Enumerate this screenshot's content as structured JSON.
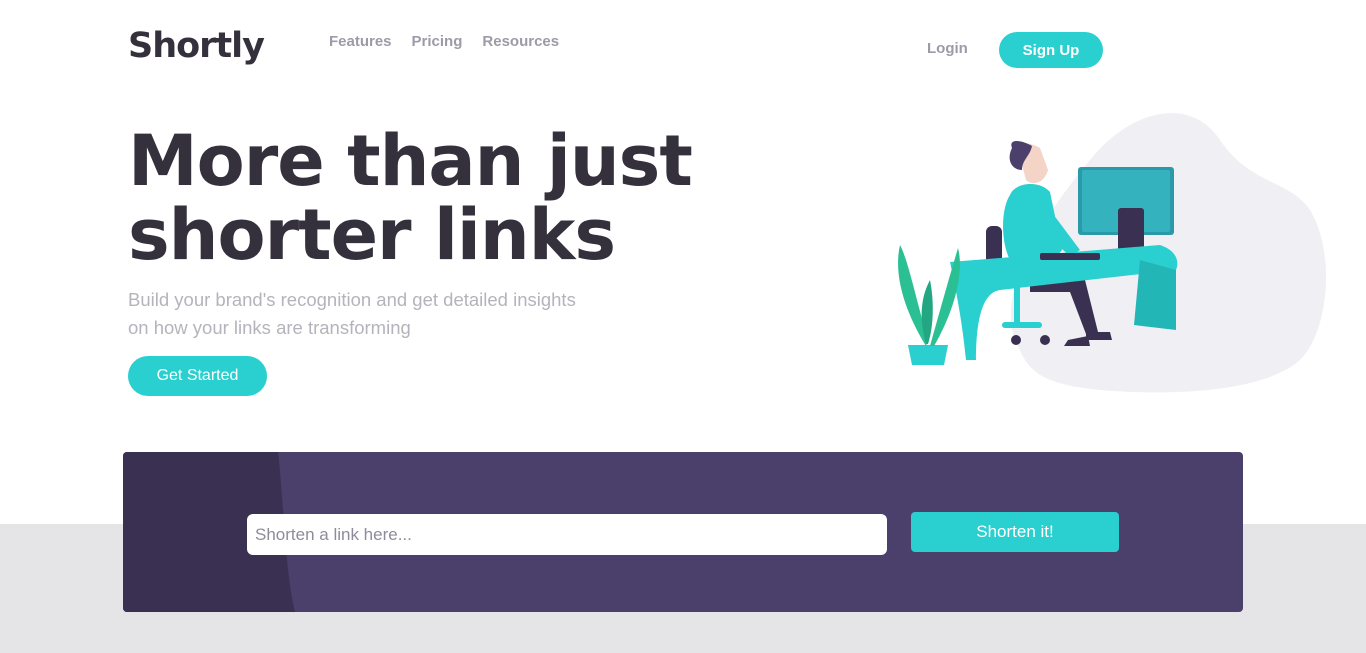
{
  "header": {
    "logo": "Shortly",
    "nav": [
      {
        "label": "Features"
      },
      {
        "label": "Pricing"
      },
      {
        "label": "Resources"
      }
    ],
    "login_label": "Login",
    "signup_label": "Sign Up"
  },
  "hero": {
    "title": "More than just shorter links",
    "subtitle": "Build your brand's recognition and get detailed insights on how your links are transforming",
    "cta_label": "Get Started"
  },
  "shorten": {
    "placeholder": "Shorten a link here...",
    "value": "",
    "button_label": "Shorten it!"
  },
  "colors": {
    "accent": "#2acfcf",
    "dark_text": "#34313d",
    "gray_text": "#9e9aa8",
    "panel": "#4b3f6b",
    "panel_dark": "#3a3052",
    "lower_bg": "#e5e5e8"
  },
  "illustration": {
    "icon": "person-working-at-desk-illustration"
  }
}
